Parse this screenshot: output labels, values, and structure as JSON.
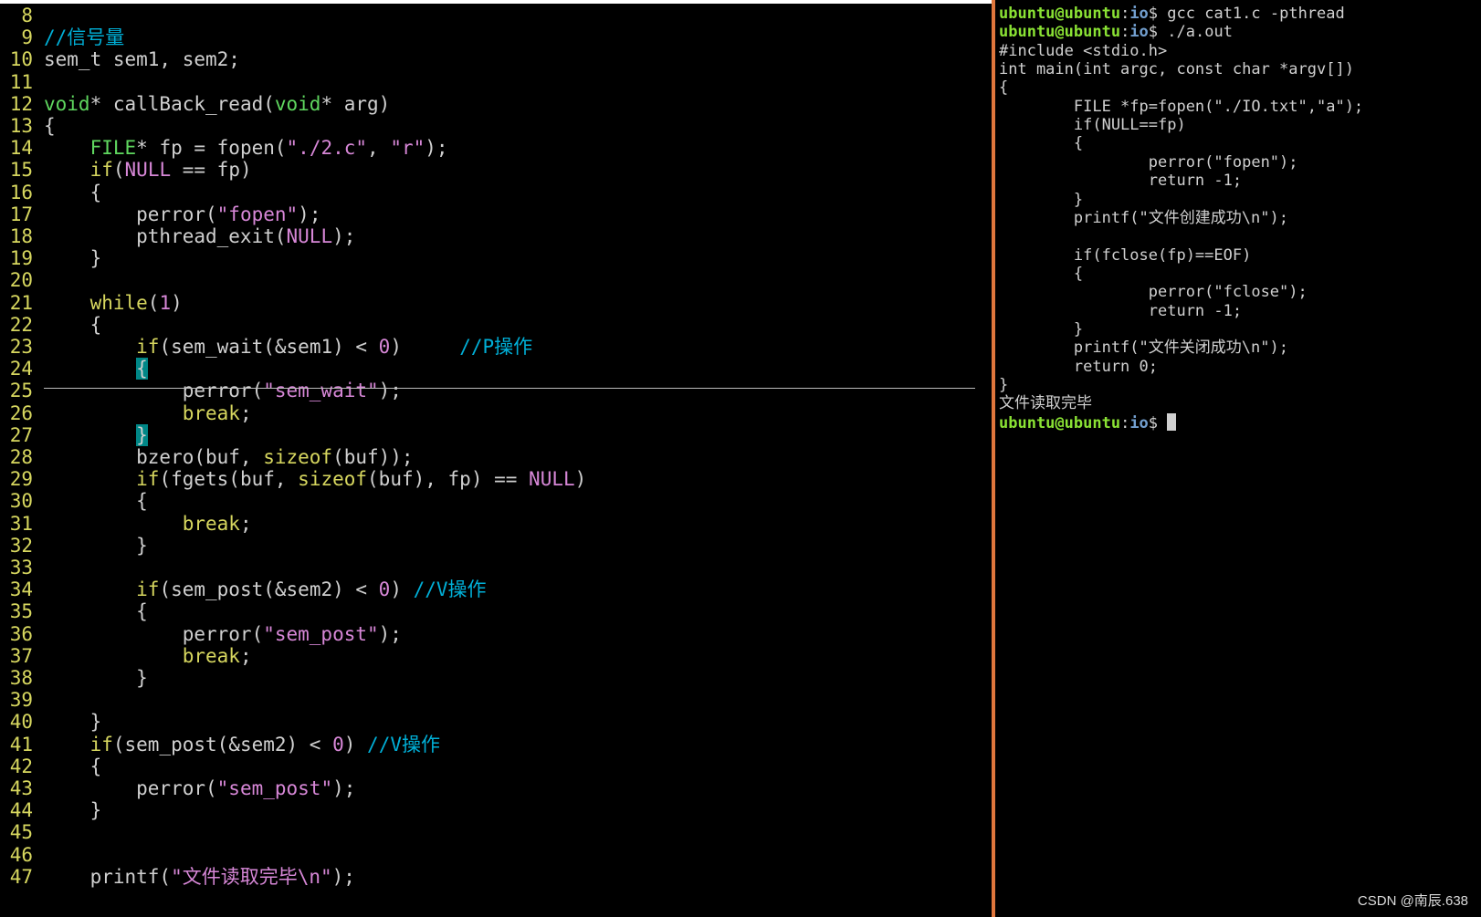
{
  "editor": {
    "lines": [
      {
        "n": "8",
        "tokens": []
      },
      {
        "n": "9",
        "tokens": [
          {
            "t": "//信号量",
            "c": "cm"
          }
        ]
      },
      {
        "n": "10",
        "tokens": [
          {
            "t": "sem_t sem1, sem2;",
            "c": "def"
          }
        ]
      },
      {
        "n": "11",
        "tokens": []
      },
      {
        "n": "12",
        "tokens": [
          {
            "t": "void",
            "c": "type"
          },
          {
            "t": "* callBack_read(",
            "c": "def"
          },
          {
            "t": "void",
            "c": "type"
          },
          {
            "t": "* arg)",
            "c": "def"
          }
        ]
      },
      {
        "n": "13",
        "tokens": [
          {
            "t": "{",
            "c": "def"
          }
        ]
      },
      {
        "n": "14",
        "tokens": [
          {
            "t": "    ",
            "c": "def"
          },
          {
            "t": "FILE",
            "c": "type"
          },
          {
            "t": "* fp = fopen(",
            "c": "def"
          },
          {
            "t": "\"./2.c\"",
            "c": "str"
          },
          {
            "t": ", ",
            "c": "def"
          },
          {
            "t": "\"r\"",
            "c": "str"
          },
          {
            "t": ");",
            "c": "def"
          }
        ]
      },
      {
        "n": "15",
        "tokens": [
          {
            "t": "    ",
            "c": "def"
          },
          {
            "t": "if",
            "c": "kw"
          },
          {
            "t": "(",
            "c": "def"
          },
          {
            "t": "NULL",
            "c": "const"
          },
          {
            "t": " == fp)",
            "c": "def"
          }
        ]
      },
      {
        "n": "16",
        "tokens": [
          {
            "t": "    {",
            "c": "def"
          }
        ]
      },
      {
        "n": "17",
        "tokens": [
          {
            "t": "        perror(",
            "c": "def"
          },
          {
            "t": "\"fopen\"",
            "c": "str"
          },
          {
            "t": ");",
            "c": "def"
          }
        ]
      },
      {
        "n": "18",
        "tokens": [
          {
            "t": "        pthread_exit(",
            "c": "def"
          },
          {
            "t": "NULL",
            "c": "const"
          },
          {
            "t": ");",
            "c": "def"
          }
        ]
      },
      {
        "n": "19",
        "tokens": [
          {
            "t": "    }",
            "c": "def"
          }
        ]
      },
      {
        "n": "20",
        "tokens": []
      },
      {
        "n": "21",
        "tokens": [
          {
            "t": "    ",
            "c": "def"
          },
          {
            "t": "while",
            "c": "kw"
          },
          {
            "t": "(",
            "c": "def"
          },
          {
            "t": "1",
            "c": "num"
          },
          {
            "t": ")",
            "c": "def"
          }
        ]
      },
      {
        "n": "22",
        "tokens": [
          {
            "t": "    {",
            "c": "def"
          }
        ]
      },
      {
        "n": "23",
        "tokens": [
          {
            "t": "        ",
            "c": "def"
          },
          {
            "t": "if",
            "c": "kw"
          },
          {
            "t": "(sem_wait(&sem1) < ",
            "c": "def"
          },
          {
            "t": "0",
            "c": "num"
          },
          {
            "t": ")     ",
            "c": "def"
          },
          {
            "t": "//P操作",
            "c": "cm"
          }
        ]
      },
      {
        "n": "24",
        "tokens": [
          {
            "t": "        ",
            "c": "def"
          },
          {
            "t": "{",
            "c": "hl"
          }
        ]
      },
      {
        "n": "25",
        "tokens": [
          {
            "t": "            perror(",
            "c": "def"
          },
          {
            "t": "\"sem_wait\"",
            "c": "str"
          },
          {
            "t": ");",
            "c": "def"
          }
        ]
      },
      {
        "n": "26",
        "tokens": [
          {
            "t": "            ",
            "c": "def"
          },
          {
            "t": "break",
            "c": "kw"
          },
          {
            "t": ";",
            "c": "def"
          }
        ]
      },
      {
        "n": "27",
        "tokens": [
          {
            "t": "        ",
            "c": "def"
          },
          {
            "t": "}",
            "c": "hl"
          }
        ]
      },
      {
        "n": "28",
        "tokens": [
          {
            "t": "        bzero(buf, ",
            "c": "def"
          },
          {
            "t": "sizeof",
            "c": "kw"
          },
          {
            "t": "(buf));",
            "c": "def"
          }
        ]
      },
      {
        "n": "29",
        "tokens": [
          {
            "t": "        ",
            "c": "def"
          },
          {
            "t": "if",
            "c": "kw"
          },
          {
            "t": "(fgets(buf, ",
            "c": "def"
          },
          {
            "t": "sizeof",
            "c": "kw"
          },
          {
            "t": "(buf), fp) == ",
            "c": "def"
          },
          {
            "t": "NULL",
            "c": "const"
          },
          {
            "t": ")",
            "c": "def"
          }
        ]
      },
      {
        "n": "30",
        "tokens": [
          {
            "t": "        {",
            "c": "def"
          }
        ]
      },
      {
        "n": "31",
        "tokens": [
          {
            "t": "            ",
            "c": "def"
          },
          {
            "t": "break",
            "c": "kw"
          },
          {
            "t": ";",
            "c": "def"
          }
        ]
      },
      {
        "n": "32",
        "tokens": [
          {
            "t": "        }",
            "c": "def"
          }
        ]
      },
      {
        "n": "33",
        "tokens": []
      },
      {
        "n": "34",
        "tokens": [
          {
            "t": "        ",
            "c": "def"
          },
          {
            "t": "if",
            "c": "kw"
          },
          {
            "t": "(sem_post(&sem2) < ",
            "c": "def"
          },
          {
            "t": "0",
            "c": "num"
          },
          {
            "t": ") ",
            "c": "def"
          },
          {
            "t": "//V操作",
            "c": "cm"
          }
        ]
      },
      {
        "n": "35",
        "tokens": [
          {
            "t": "        {",
            "c": "def"
          }
        ]
      },
      {
        "n": "36",
        "tokens": [
          {
            "t": "            perror(",
            "c": "def"
          },
          {
            "t": "\"sem_post\"",
            "c": "str"
          },
          {
            "t": ");",
            "c": "def"
          }
        ]
      },
      {
        "n": "37",
        "tokens": [
          {
            "t": "            ",
            "c": "def"
          },
          {
            "t": "break",
            "c": "kw"
          },
          {
            "t": ";",
            "c": "def"
          }
        ]
      },
      {
        "n": "38",
        "tokens": [
          {
            "t": "        }",
            "c": "def"
          }
        ]
      },
      {
        "n": "39",
        "tokens": []
      },
      {
        "n": "40",
        "tokens": [
          {
            "t": "    }",
            "c": "def"
          }
        ]
      },
      {
        "n": "41",
        "tokens": [
          {
            "t": "    ",
            "c": "def"
          },
          {
            "t": "if",
            "c": "kw"
          },
          {
            "t": "(sem_post(&sem2) < ",
            "c": "def"
          },
          {
            "t": "0",
            "c": "num"
          },
          {
            "t": ") ",
            "c": "def"
          },
          {
            "t": "//V操作",
            "c": "cm"
          }
        ]
      },
      {
        "n": "42",
        "tokens": [
          {
            "t": "    {",
            "c": "def"
          }
        ]
      },
      {
        "n": "43",
        "tokens": [
          {
            "t": "        perror(",
            "c": "def"
          },
          {
            "t": "\"sem_post\"",
            "c": "str"
          },
          {
            "t": ");",
            "c": "def"
          }
        ]
      },
      {
        "n": "44",
        "tokens": [
          {
            "t": "    }",
            "c": "def"
          }
        ]
      },
      {
        "n": "45",
        "tokens": []
      },
      {
        "n": "46",
        "tokens": []
      },
      {
        "n": "47",
        "tokens": [
          {
            "t": "    printf(",
            "c": "def"
          },
          {
            "t": "\"文件读取完毕\\n\"",
            "c": "str"
          },
          {
            "t": ");",
            "c": "def"
          }
        ]
      }
    ]
  },
  "terminal": {
    "prompt": {
      "user": "ubuntu@ubuntu",
      "sep": ":",
      "path": "io",
      "dollar": "$"
    },
    "lines": [
      {
        "type": "cmd",
        "text": " gcc cat1.c -pthread"
      },
      {
        "type": "cmd",
        "text": " ./a.out"
      },
      {
        "type": "out",
        "text": "#include <stdio.h>"
      },
      {
        "type": "out",
        "text": "int main(int argc, const char *argv[])"
      },
      {
        "type": "out",
        "text": "{"
      },
      {
        "type": "out",
        "text": "        FILE *fp=fopen(\"./IO.txt\",\"a\");"
      },
      {
        "type": "out",
        "text": "        if(NULL==fp)"
      },
      {
        "type": "out",
        "text": "        {"
      },
      {
        "type": "out",
        "text": "                perror(\"fopen\");"
      },
      {
        "type": "out",
        "text": "                return -1;"
      },
      {
        "type": "out",
        "text": "        }"
      },
      {
        "type": "out",
        "text": "        printf(\"文件创建成功\\n\");"
      },
      {
        "type": "out",
        "text": ""
      },
      {
        "type": "out",
        "text": "        if(fclose(fp)==EOF)"
      },
      {
        "type": "out",
        "text": "        {"
      },
      {
        "type": "out",
        "text": "                perror(\"fclose\");"
      },
      {
        "type": "out",
        "text": "                return -1;"
      },
      {
        "type": "out",
        "text": "        }"
      },
      {
        "type": "out",
        "text": "        printf(\"文件关闭成功\\n\");"
      },
      {
        "type": "out",
        "text": "        return 0;"
      },
      {
        "type": "out",
        "text": "}"
      },
      {
        "type": "out",
        "text": "文件读取完毕"
      },
      {
        "type": "prompt",
        "text": " "
      }
    ]
  },
  "watermark": "CSDN @南辰.638"
}
